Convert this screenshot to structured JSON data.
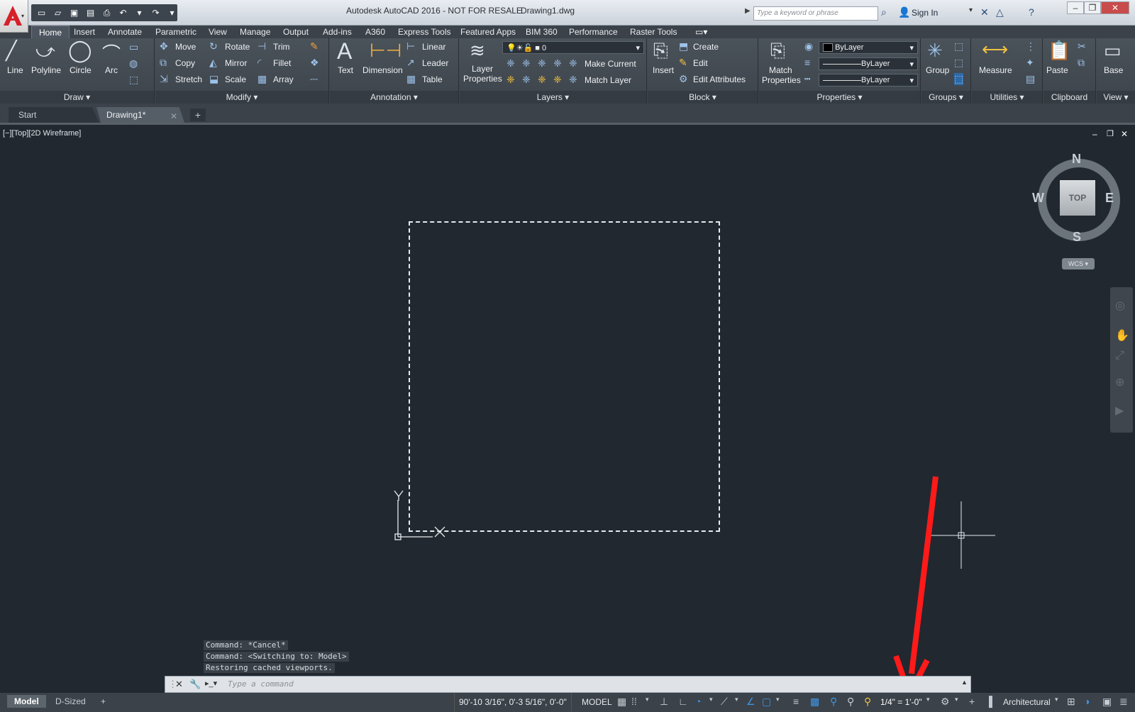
{
  "titlebar": {
    "app_title": "Autodesk AutoCAD 2016 - NOT FOR RESALE",
    "file_name": "Drawing1.dwg",
    "search_placeholder": "Type a keyword or phrase",
    "sign_in": "Sign In"
  },
  "ribbon_tabs": [
    "Home",
    "Insert",
    "Annotate",
    "Parametric",
    "View",
    "Manage",
    "Output",
    "Add-ins",
    "A360",
    "Express Tools",
    "Featured Apps",
    "BIM 360",
    "Performance",
    "Raster Tools"
  ],
  "draw": {
    "title": "Draw",
    "line": "Line",
    "polyline": "Polyline",
    "circle": "Circle",
    "arc": "Arc"
  },
  "modify": {
    "title": "Modify",
    "move": "Move",
    "rotate": "Rotate",
    "trim": "Trim",
    "copy": "Copy",
    "mirror": "Mirror",
    "fillet": "Fillet",
    "stretch": "Stretch",
    "scale": "Scale",
    "array": "Array"
  },
  "annotation": {
    "title": "Annotation",
    "text": "Text",
    "dimension": "Dimension",
    "linear": "Linear",
    "leader": "Leader",
    "table": "Table"
  },
  "layers": {
    "title": "Layers",
    "layer_properties_1": "Layer",
    "layer_properties_2": "Properties",
    "current_layer": "0",
    "make_current": "Make Current",
    "match_layer": "Match Layer"
  },
  "block": {
    "title": "Block",
    "insert": "Insert",
    "create": "Create",
    "edit": "Edit",
    "edit_attributes": "Edit Attributes"
  },
  "properties": {
    "title": "Properties",
    "match_1": "Match",
    "match_2": "Properties",
    "color": "ByLayer",
    "linetype": "ByLayer",
    "lineweight": "ByLayer"
  },
  "groups": {
    "title": "Groups",
    "group": "Group"
  },
  "utilities": {
    "title": "Utilities",
    "measure": "Measure"
  },
  "clipboard": {
    "title": "Clipboard",
    "paste": "Paste"
  },
  "view_panel": {
    "title": "View",
    "base": "Base"
  },
  "doc_tabs": {
    "start": "Start",
    "drawing": "Drawing1*"
  },
  "viewport": {
    "label": "[−][Top][2D Wireframe]",
    "viewcube_face": "TOP",
    "compass": {
      "n": "N",
      "s": "S",
      "e": "E",
      "w": "W"
    },
    "ucs_label": "WCS"
  },
  "command": {
    "history": [
      "Command: *Cancel*",
      "Command:   <Switching to: Model>",
      "Restoring cached viewports."
    ],
    "placeholder": "Type a command"
  },
  "status": {
    "layout_model": "Model",
    "layout_dsized": "D-Sized",
    "coordinates": "90'-10 3/16\", 0'-3 5/16\", 0'-0\"",
    "mode": "MODEL",
    "annotation_scale": "1/4\" = 1'-0\"",
    "units": "Architectural"
  },
  "colors": {
    "accent_red": "#ff1a1a",
    "viewport_bg": "#212830",
    "ribbon_bg": "#434a52"
  }
}
